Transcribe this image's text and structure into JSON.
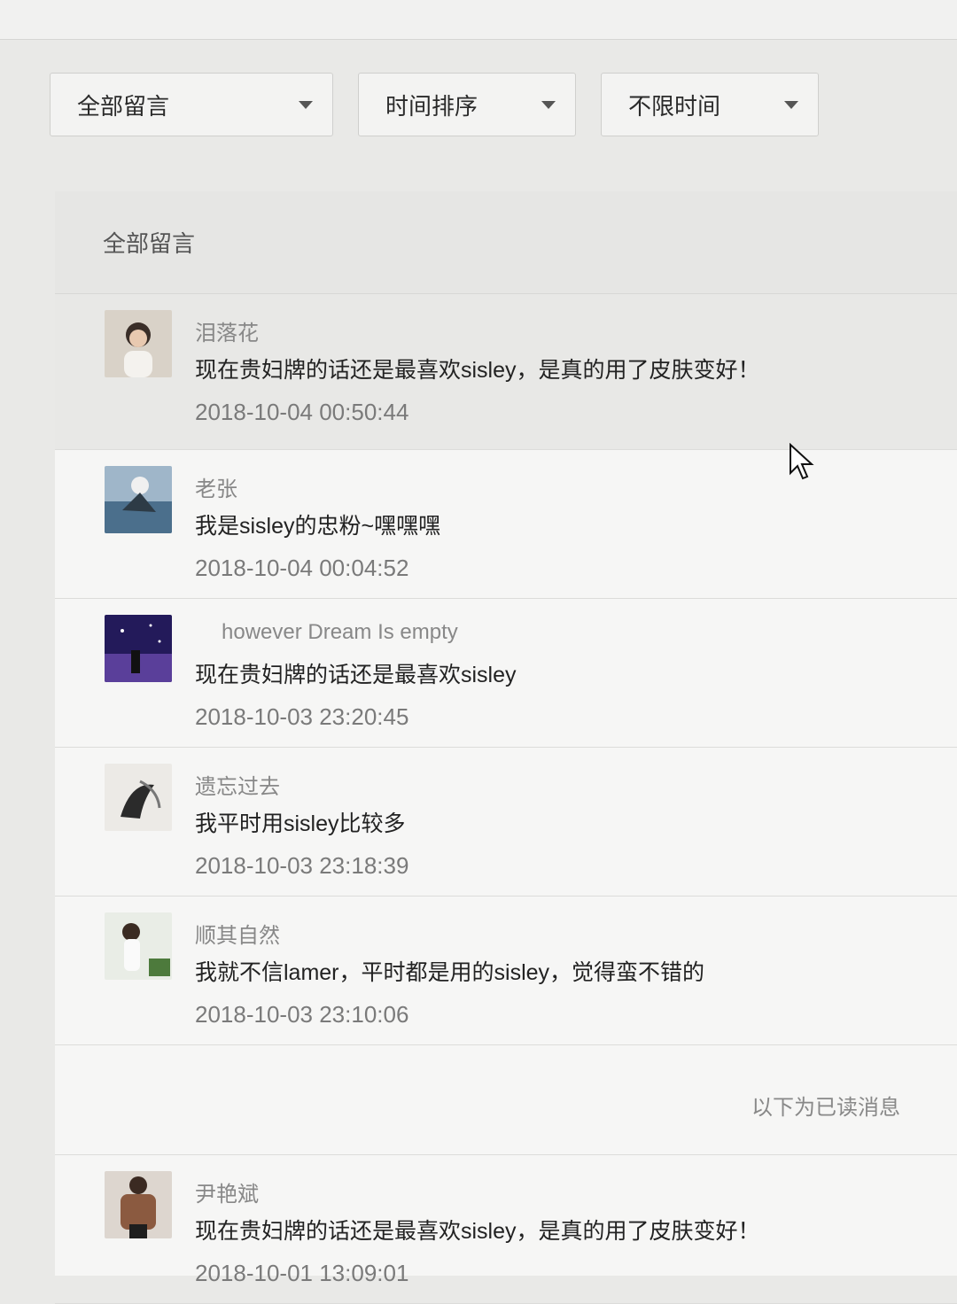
{
  "filters": [
    {
      "label": "全部留言"
    },
    {
      "label": "时间排序"
    },
    {
      "label": "不限时间"
    }
  ],
  "panel": {
    "title": "全部留言"
  },
  "messages": [
    {
      "name": "泪落花",
      "text": "现在贵妇牌的话还是最喜欢sisley，是真的用了皮肤变好！",
      "time": "2018-10-04 00:50:44"
    },
    {
      "name": "老张",
      "text": "我是sisley的忠粉~嘿嘿嘿",
      "time": "2018-10-04 00:04:52"
    },
    {
      "name": "however Dream Is empty",
      "text": "现在贵妇牌的话还是最喜欢sisley",
      "time": "2018-10-03 23:20:45"
    },
    {
      "name": "遗忘过去",
      "text": "我平时用sisley比较多",
      "time": "2018-10-03 23:18:39"
    },
    {
      "name": "顺其自然",
      "text": "我就不信lamer，平时都是用的sisley，觉得蛮不错的",
      "time": "2018-10-03 23:10:06"
    }
  ],
  "read_divider": "以下为已读消息",
  "read_messages": [
    {
      "name": "尹艳斌",
      "text": "现在贵妇牌的话还是最喜欢sisley，是真的用了皮肤变好！",
      "time": "2018-10-01 13:09:01"
    }
  ],
  "colors": {
    "background": "#e9e9e7",
    "panel": "#f6f6f5",
    "highlight": "#e8e8e6"
  }
}
